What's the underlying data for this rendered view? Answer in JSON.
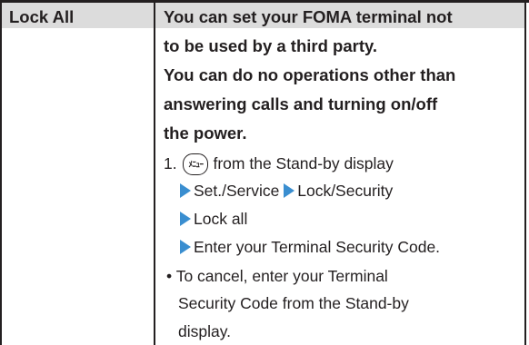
{
  "entry": {
    "term": "Lock All",
    "description_lines": [
      "You can set your FOMA terminal not",
      "to be used by a third party.",
      "You can do no operations other than",
      "answering calls and turning on/off",
      "the power."
    ]
  },
  "steps": {
    "step_number": "1.",
    "key_icon": "menu-key-icon",
    "step_text": "from the Stand-by display",
    "nav": [
      "Set./Service",
      "Lock/Security",
      "Lock all",
      "Enter your Terminal Security Code."
    ]
  },
  "note": {
    "bullet": "•",
    "lines": [
      "To cancel, enter your Terminal",
      "Security Code from the Stand-by",
      "display."
    ]
  },
  "colors": {
    "header_bg": "#dcdcdc",
    "arrow": "#3a8ed0",
    "text": "#231f20"
  }
}
